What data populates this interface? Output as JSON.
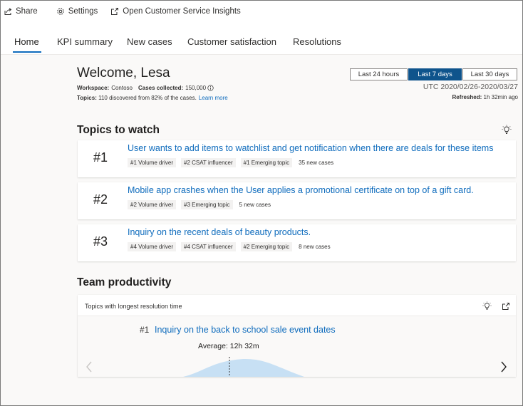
{
  "toolbar": {
    "share_label": "Share",
    "settings_label": "Settings",
    "open_insights_label": "Open Customer Service Insights"
  },
  "tabs": [
    {
      "label": "Home",
      "active": true
    },
    {
      "label": "KPI summary",
      "active": false
    },
    {
      "label": "New cases",
      "active": false
    },
    {
      "label": "Customer satisfaction",
      "active": false
    },
    {
      "label": "Resolutions",
      "active": false
    }
  ],
  "header": {
    "welcome": "Welcome, Lesa",
    "workspace_label": "Workspace:",
    "workspace_value": "Contoso",
    "cases_label": "Cases collected:",
    "cases_value": "150,000",
    "topics_label": "Topics:",
    "topics_text": "110 discovered from 82% of the cases.",
    "learn_more": "Learn more"
  },
  "date_range": {
    "options": [
      "Last 24 hours",
      "Last 7 days",
      "Last 30 days"
    ],
    "selected": "Last 7 days",
    "utc_range": "UTC 2020/02/26-2020/03/27",
    "refreshed_label": "Refreshed:",
    "refreshed_value": "1h 32min ago"
  },
  "topics_to_watch": {
    "title": "Topics to watch",
    "items": [
      {
        "rank": "#1",
        "title": "User wants to add items to watchlist and get notification when there are deals for these items",
        "tags": [
          "#1 Volume driver",
          "#2 CSAT influencer",
          "#1 Emerging topic"
        ],
        "new_cases": "35 new cases"
      },
      {
        "rank": "#2",
        "title": "Mobile app crashes when the User applies a promotional certificate on top of a gift card.",
        "tags": [
          "#2 Volume driver",
          "#3 Emerging topic"
        ],
        "new_cases": "5 new cases"
      },
      {
        "rank": "#3",
        "title": "Inquiry on the recent deals of beauty products.",
        "tags": [
          "#4 Volume driver",
          "#4 CSAT influencer",
          "#2 Emerging topic"
        ],
        "new_cases": "8 new cases"
      }
    ]
  },
  "team_productivity": {
    "title": "Team productivity",
    "panel_title": "Topics with longest resolution time",
    "rank": "#1",
    "topic_title": "Inquiry on the back to school sale event dates",
    "average": "Average: 12h 32m"
  },
  "colors": {
    "accent": "#0f6cbd",
    "selected_range": "#0f548c",
    "curve_fill": "#c7e0f4"
  },
  "icons": {
    "share": "share-icon",
    "settings": "gear-icon",
    "open": "open-external-icon",
    "idea": "lightbulb-icon",
    "expand": "expand-icon",
    "prev": "chevron-left-icon",
    "next": "chevron-right-icon"
  }
}
